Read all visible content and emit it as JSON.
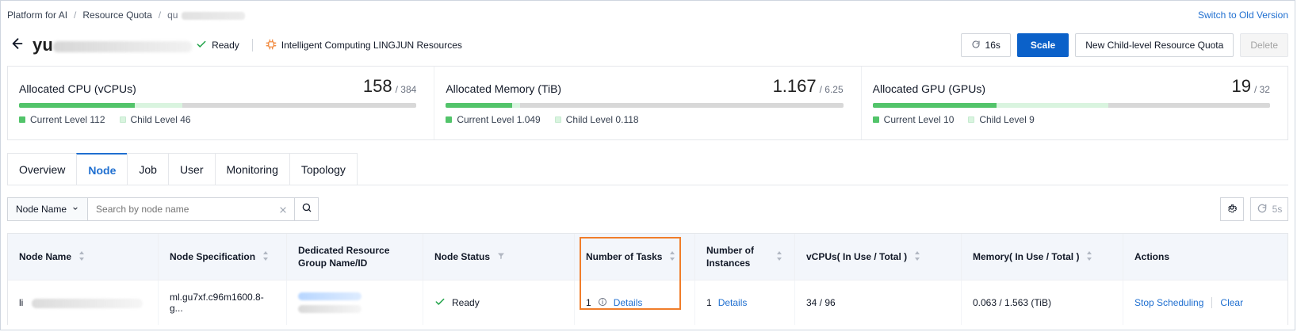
{
  "breadcrumb": {
    "items": [
      "Platform for AI",
      "Resource Quota",
      "qu"
    ],
    "separator": "/"
  },
  "top_actions": {
    "switch_old_version": "Switch to Old Version"
  },
  "header": {
    "title": "yu",
    "status": "Ready",
    "resource_type": "Intelligent Computing LINGJUN Resources",
    "buttons": {
      "refresh_label": "16s",
      "scale_label": "Scale",
      "new_child_label": "New Child-level Resource Quota",
      "delete_label": "Delete"
    }
  },
  "allocations": [
    {
      "title": "Allocated CPU (vCPUs)",
      "value": "158",
      "total": "/ 384",
      "current_level_label": "Current Level 112",
      "child_level_label": "Child Level 46",
      "current_level_value": 112,
      "child_level_value": 46,
      "total_value": 384
    },
    {
      "title": "Allocated Memory (TiB)",
      "value": "1.167",
      "total": "/ 6.25",
      "current_level_label": "Current Level 1.049",
      "child_level_label": "Child Level 0.118",
      "current_level_value": 1.049,
      "child_level_value": 0.118,
      "total_value": 6.25
    },
    {
      "title": "Allocated GPU (GPUs)",
      "value": "19",
      "total": "/ 32",
      "current_level_label": "Current Level 10",
      "child_level_label": "Child Level 9",
      "current_level_value": 10,
      "child_level_value": 9,
      "total_value": 32
    }
  ],
  "tabs": {
    "items": [
      "Overview",
      "Node",
      "Job",
      "User",
      "Monitoring",
      "Topology"
    ],
    "active": "Node"
  },
  "filters": {
    "select_label": "Node Name",
    "search_placeholder": "Search by node name",
    "right_refresh_label": "5s"
  },
  "table": {
    "headers": [
      "Node Name",
      "Node Specification",
      "Dedicated Resource Group Name/ID",
      "Node Status",
      "Number of Tasks",
      "Number of Instances",
      "vCPUs( In Use / Total )",
      "Memory( In Use / Total )",
      "Actions"
    ],
    "rows": [
      {
        "node_name": "li",
        "node_spec": "ml.gu7xf.c96m1600.8-g...",
        "status": "Ready",
        "tasks": "1",
        "tasks_link": "Details",
        "instances": "1",
        "instances_link": "Details",
        "vcpus": "34 / 96",
        "memory": "0.063 / 1.563 (TiB)",
        "actions": [
          "Stop Scheduling",
          "Clear"
        ]
      }
    ]
  },
  "colors": {
    "accent_blue": "#0b61c9",
    "link_blue": "#1f6fd0",
    "bar_current_green": "#52c46a",
    "bar_child_green": "#d9f4df",
    "highlight_orange": "#f07d2a"
  },
  "icons": {
    "back": "arrow-left-icon",
    "status_ok": "check-icon",
    "resource": "chip-icon",
    "refresh": "refresh-icon",
    "settings": "gear-icon",
    "search": "search-icon",
    "clear": "close-icon",
    "sort": "sort-icon",
    "filter": "filter-icon",
    "info": "info-icon"
  }
}
